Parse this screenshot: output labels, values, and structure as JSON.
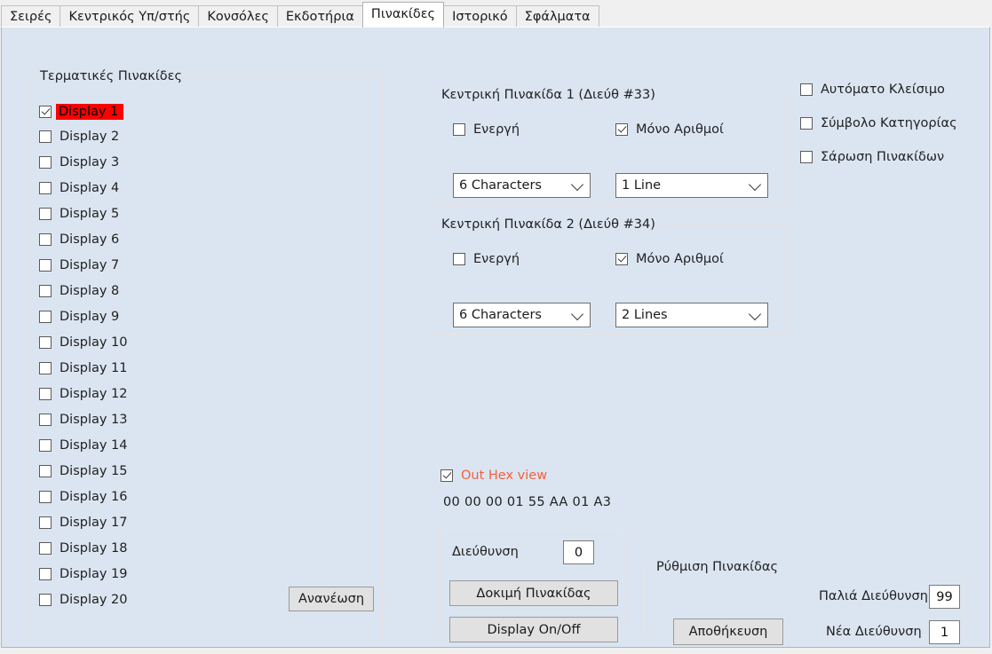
{
  "window": {
    "background_color": "#dbe5f1",
    "tab_bar_color": "#f0f0f0"
  },
  "tabs": [
    {
      "label": "Σειρές",
      "selected": false
    },
    {
      "label": "Κεντρικός Υπ/στής",
      "selected": false
    },
    {
      "label": "Κονσόλες",
      "selected": false
    },
    {
      "label": "Εκδοτήρια",
      "selected": false
    },
    {
      "label": "Πινακίδες",
      "selected": true
    },
    {
      "label": "Ιστορικό",
      "selected": false
    },
    {
      "label": "Σφάλματα",
      "selected": false
    }
  ],
  "terminal_displays": {
    "title": "Τερματικές Πινακίδες",
    "refresh_button": "Ανανέωση",
    "highlight_color": "#ff0000",
    "items": [
      {
        "label": "Display 1",
        "checked": true,
        "highlighted": true
      },
      {
        "label": "Display 2",
        "checked": false,
        "highlighted": false
      },
      {
        "label": "Display 3",
        "checked": false,
        "highlighted": false
      },
      {
        "label": "Display 4",
        "checked": false,
        "highlighted": false
      },
      {
        "label": "Display 5",
        "checked": false,
        "highlighted": false
      },
      {
        "label": "Display 6",
        "checked": false,
        "highlighted": false
      },
      {
        "label": "Display 7",
        "checked": false,
        "highlighted": false
      },
      {
        "label": "Display 8",
        "checked": false,
        "highlighted": false
      },
      {
        "label": "Display 9",
        "checked": false,
        "highlighted": false
      },
      {
        "label": "Display 10",
        "checked": false,
        "highlighted": false
      },
      {
        "label": "Display 11",
        "checked": false,
        "highlighted": false
      },
      {
        "label": "Display 12",
        "checked": false,
        "highlighted": false
      },
      {
        "label": "Display 13",
        "checked": false,
        "highlighted": false
      },
      {
        "label": "Display 14",
        "checked": false,
        "highlighted": false
      },
      {
        "label": "Display 15",
        "checked": false,
        "highlighted": false
      },
      {
        "label": "Display 16",
        "checked": false,
        "highlighted": false
      },
      {
        "label": "Display 17",
        "checked": false,
        "highlighted": false
      },
      {
        "label": "Display 18",
        "checked": false,
        "highlighted": false
      },
      {
        "label": "Display 19",
        "checked": false,
        "highlighted": false
      },
      {
        "label": "Display 20",
        "checked": false,
        "highlighted": false
      }
    ]
  },
  "central_display_1": {
    "title": "Κεντρική Πινακίδα 1 (Διεύθ #33)",
    "active_label": "Ενεργή",
    "active_checked": false,
    "numbers_only_label": "Μόνο Αριθμοί",
    "numbers_only_checked": true,
    "characters_value": "6 Characters",
    "lines_value": "1 Line"
  },
  "central_display_2": {
    "title": "Κεντρική Πινακίδα 2 (Διεύθ #34)",
    "active_label": "Ενεργή",
    "active_checked": false,
    "numbers_only_label": "Μόνο Αριθμοί",
    "numbers_only_checked": true,
    "characters_value": "6 Characters",
    "lines_value": "2 Lines"
  },
  "options": [
    {
      "label": "Αυτόματο Κλείσιμο",
      "checked": false
    },
    {
      "label": "Σύμβολο Κατηγορίας",
      "checked": false
    },
    {
      "label": "Σάρωση Πινακίδων",
      "checked": false
    }
  ],
  "hex_view": {
    "checkbox_label": "Out Hex view",
    "checked": true,
    "label_color": "#f4603c",
    "hex_value": "00 00 00 01 55 AA 01 A3"
  },
  "address_panel": {
    "address_label": "Διεύθυνση",
    "address_value": "0",
    "test_button": "Δοκιμή Πινακίδας",
    "onoff_button": "Display On/Off"
  },
  "display_setup": {
    "title": "Ρύθμιση Πινακίδας",
    "old_address_label": "Παλιά Διεύθυνση",
    "old_address_value": "99",
    "new_address_label": "Νέα Διεύθυνση",
    "new_address_value": "1",
    "save_button": "Αποθήκευση"
  }
}
